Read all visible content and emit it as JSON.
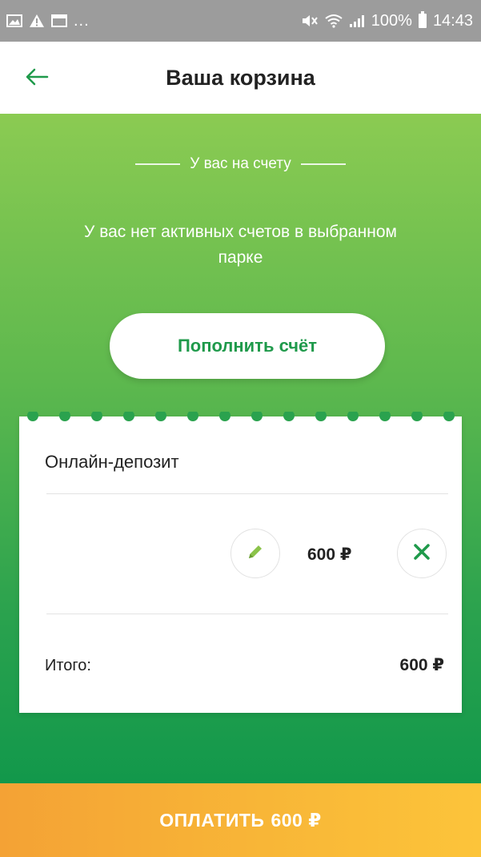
{
  "status_bar": {
    "left_icons": [
      "image-icon",
      "warning-icon",
      "window-icon"
    ],
    "left_more": "...",
    "battery_percent": "100%",
    "time": "14:43"
  },
  "app_bar": {
    "title": "Ваша корзина"
  },
  "balance": {
    "heading": "У вас на счету",
    "message": "У вас нет активных счетов в выбранном парке",
    "topup_label": "Пополнить счёт"
  },
  "cart": {
    "item_title": "Онлайн-депозит",
    "item_amount": "600 ₽",
    "total_label": "Итого:",
    "total_value": "600 ₽"
  },
  "pay": {
    "label": "ОПЛАТИТЬ",
    "amount": "600 ₽"
  },
  "colors": {
    "accent_green": "#1f9a4b",
    "pay_orange": "#f8b637",
    "status_bar_gray": "#9c9c9c"
  }
}
